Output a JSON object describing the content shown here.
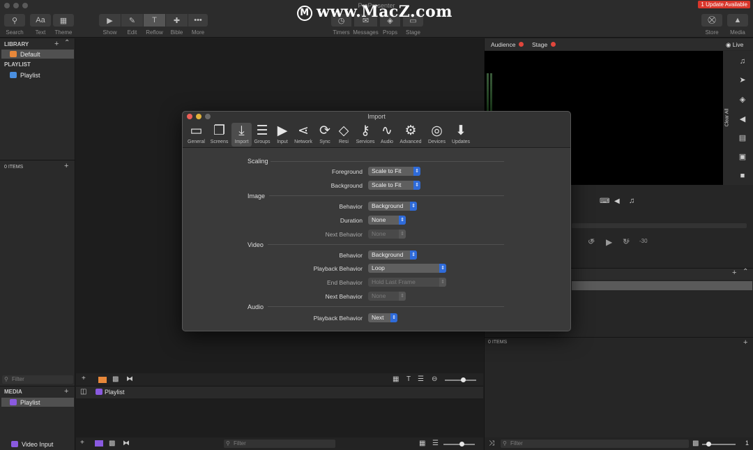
{
  "window": {
    "title": "ProPresenter",
    "update_badge": "1 Update Available"
  },
  "watermark": {
    "logo_glyph": "M",
    "text": "www.MacZ.com"
  },
  "toolbar": {
    "left": [
      {
        "label": "Search",
        "glyph": "⚲"
      },
      {
        "label": "Text",
        "glyph": "Aa"
      },
      {
        "label": "Theme",
        "glyph": "▦"
      }
    ],
    "mode": [
      {
        "label": "Show",
        "glyph": "▶"
      },
      {
        "label": "Edit",
        "glyph": "✎"
      },
      {
        "label": "Reflow",
        "glyph": "T"
      },
      {
        "label": "Bible",
        "glyph": "✚"
      },
      {
        "label": "More",
        "glyph": "•••"
      }
    ],
    "center": [
      {
        "label": "Timers",
        "glyph": "◷"
      },
      {
        "label": "Messages",
        "glyph": "✉"
      },
      {
        "label": "Props",
        "glyph": "◈"
      },
      {
        "label": "Stage",
        "glyph": "▭"
      }
    ],
    "right": [
      {
        "label": "Store",
        "glyph": "⛒"
      },
      {
        "label": "Media",
        "glyph": "▲"
      }
    ]
  },
  "left": {
    "library_header": "LIBRARY",
    "library_items": [
      {
        "label": "Default",
        "color": "#e8883a"
      }
    ],
    "playlist_header": "PLAYLIST",
    "playlist_items": [
      {
        "label": "Playlist",
        "color": "#4a8fe0"
      }
    ],
    "items_count": "0 ITEMS",
    "filter_placeholder": "Filter",
    "media_header": "MEDIA",
    "media_items": [
      {
        "label": "Playlist",
        "color": "#8a5ae0"
      }
    ],
    "video_input": "Video Input"
  },
  "right": {
    "audience": "Audience",
    "stage": "Stage",
    "live": "Live",
    "clear_all": "Clear All",
    "items_count": "0 ITEMS",
    "filter_placeholder": "Filter",
    "count_right": "1",
    "skip_back": "15",
    "skip_fwd": "15",
    "skip_back2": "-30"
  },
  "center": {
    "bottom_playlist": "Playlist",
    "bottom_filter": "Filter"
  },
  "dialog": {
    "title": "Import",
    "tabs": [
      {
        "label": "General",
        "glyph": "▭"
      },
      {
        "label": "Screens",
        "glyph": "❐"
      },
      {
        "label": "Import",
        "glyph": "⤓"
      },
      {
        "label": "Groups",
        "glyph": "☰"
      },
      {
        "label": "Input",
        "glyph": "▶"
      },
      {
        "label": "Network",
        "glyph": "⋖"
      },
      {
        "label": "Sync",
        "glyph": "⟳"
      },
      {
        "label": "Resi",
        "glyph": "◇"
      },
      {
        "label": "Services",
        "glyph": "⚷"
      },
      {
        "label": "Audio",
        "glyph": "∿"
      },
      {
        "label": "Advanced",
        "glyph": "⚙"
      },
      {
        "label": "Devices",
        "glyph": "◎"
      },
      {
        "label": "Updates",
        "glyph": "⬇"
      }
    ],
    "selected_tab": "Import",
    "sections": {
      "scaling": "Scaling",
      "image": "Image",
      "video": "Video",
      "audio": "Audio"
    },
    "rows": {
      "foreground": {
        "label": "Foreground",
        "value": "Scale to Fit"
      },
      "background": {
        "label": "Background",
        "value": "Scale to Fit"
      },
      "image_behavior": {
        "label": "Behavior",
        "value": "Background"
      },
      "image_duration": {
        "label": "Duration",
        "value": "None"
      },
      "image_next": {
        "label": "Next Behavior",
        "value": "None"
      },
      "video_behavior": {
        "label": "Behavior",
        "value": "Background"
      },
      "video_playback": {
        "label": "Playback Behavior",
        "value": "Loop"
      },
      "video_end": {
        "label": "End Behavior",
        "value": "Hold Last Frame"
      },
      "video_next": {
        "label": "Next Behavior",
        "value": "None"
      },
      "audio_playback": {
        "label": "Playback Behavior",
        "value": "Next"
      }
    }
  }
}
